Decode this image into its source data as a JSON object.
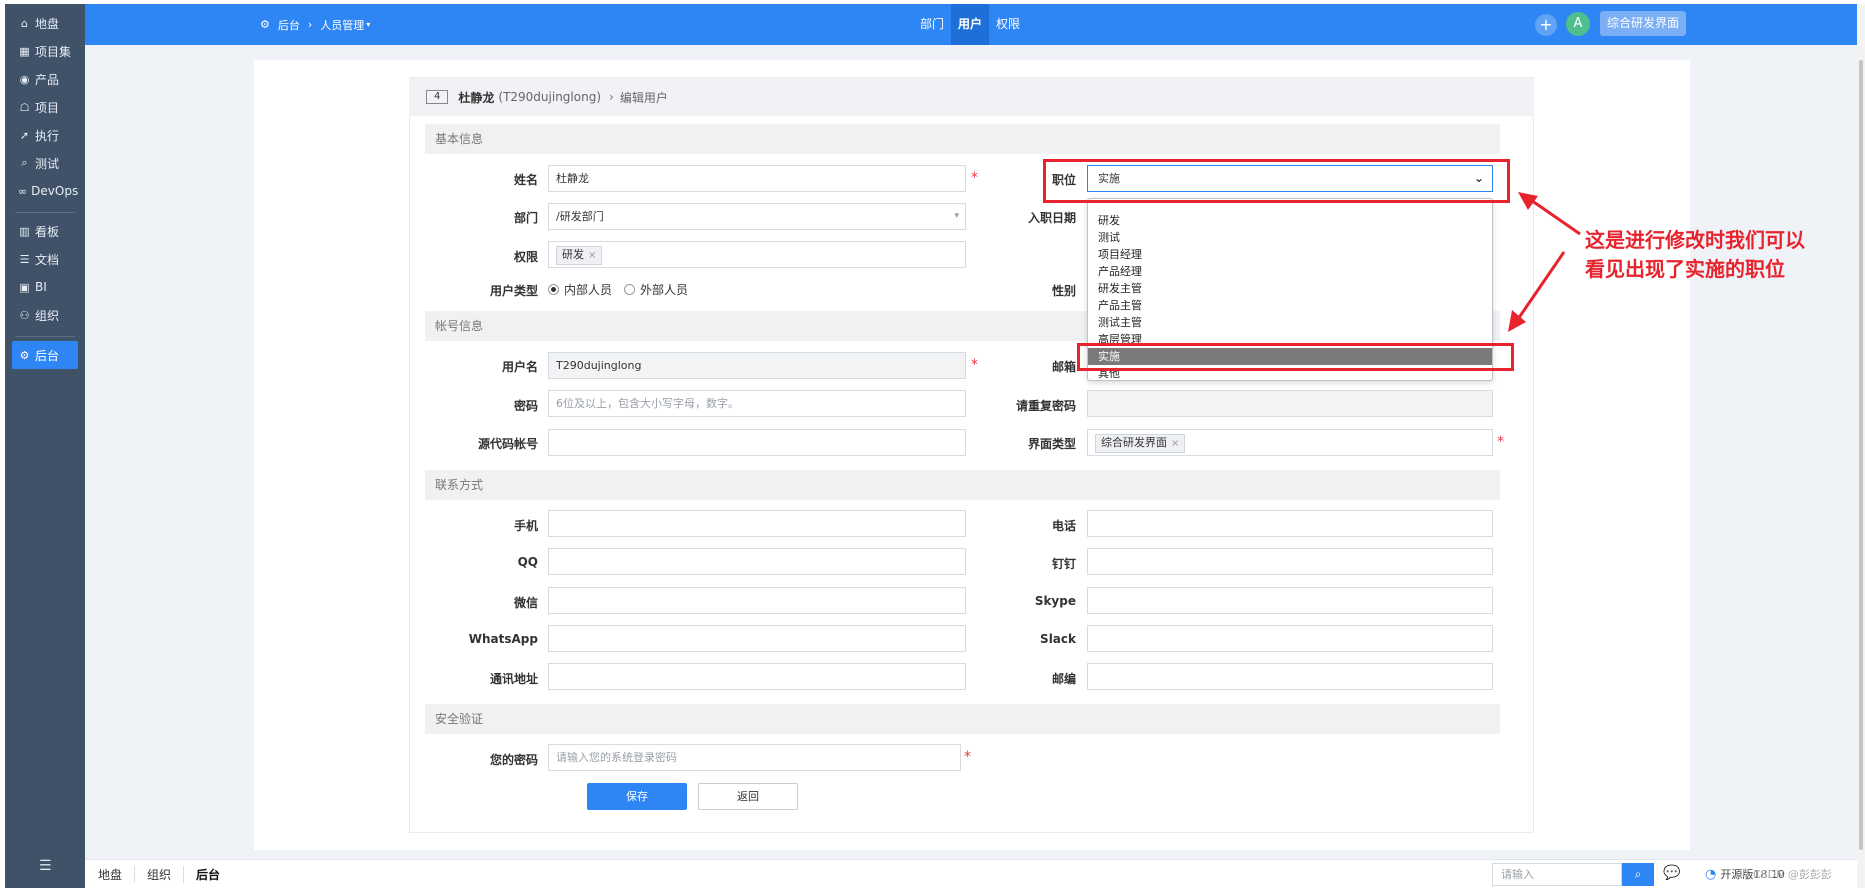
{
  "sidebar": {
    "items": [
      {
        "icon": "home-icon",
        "glyph": "⌂",
        "label": "地盘"
      },
      {
        "icon": "grid-icon",
        "glyph": "▦",
        "label": "项目集"
      },
      {
        "icon": "product-icon",
        "glyph": "◉",
        "label": "产品"
      },
      {
        "icon": "project-icon",
        "glyph": "☖",
        "label": "项目"
      },
      {
        "icon": "execute-icon",
        "glyph": "➚",
        "label": "执行"
      },
      {
        "icon": "test-icon",
        "glyph": "⌕",
        "label": "测试"
      },
      {
        "icon": "devops-icon",
        "glyph": "∞",
        "label": "DevOps"
      },
      {
        "icon": "kanban-icon",
        "glyph": "▥",
        "label": "看板"
      },
      {
        "icon": "doc-icon",
        "glyph": "☰",
        "label": "文档"
      },
      {
        "icon": "bi-icon",
        "glyph": "▣",
        "label": "BI"
      },
      {
        "icon": "org-icon",
        "glyph": "⚇",
        "label": "组织"
      },
      {
        "icon": "admin-icon",
        "glyph": "⚙",
        "label": "后台"
      }
    ],
    "collapse_glyph": "☰"
  },
  "header": {
    "crumb_home": "后台",
    "crumb_page": "人员管理",
    "tabs": [
      "部门",
      "用户",
      "权限"
    ],
    "plus": "+",
    "avatar": "A",
    "ui_switch": "综合研发界面"
  },
  "title_bar": {
    "id": "4",
    "name": "杜静龙",
    "account": "(T290dujinglong)",
    "sep": "›",
    "action": "编辑用户"
  },
  "sections": {
    "basic": "基本信息",
    "account": "帐号信息",
    "contact": "联系方式",
    "security": "安全验证"
  },
  "labels": {
    "realname": "姓名",
    "dept": "部门",
    "priv": "权限",
    "user_type": "用户类型",
    "role": "职位",
    "join_date": "入职日期",
    "gender": "性别",
    "account": "用户名",
    "email": "邮箱",
    "password": "密码",
    "password2": "请重复密码",
    "commiter": "源代码帐号",
    "vision": "界面类型",
    "mobile": "手机",
    "phone": "电话",
    "qq": "QQ",
    "dingding": "钉钉",
    "weixin": "微信",
    "skype": "Skype",
    "whatsapp": "WhatsApp",
    "slack": "Slack",
    "address": "通讯地址",
    "zipcode": "邮编",
    "verify": "您的密码"
  },
  "values": {
    "realname": "杜静龙",
    "dept": "/研发部门",
    "priv_chip": "研发",
    "user_type_inside": "内部人员",
    "user_type_outside": "外部人员",
    "role": "实施",
    "account": "T290dujinglong",
    "password_ph": "6位及以上，包含大小写字母，数字。",
    "vision_chip": "综合研发界面",
    "verify_ph": "请输入您的系统登录密码",
    "required_mark": "*",
    "chip_close": "×"
  },
  "role_dropdown": {
    "options": [
      "研发",
      "测试",
      "项目经理",
      "产品经理",
      "研发主管",
      "产品主管",
      "测试主管",
      "高层管理",
      "实施",
      "其他"
    ],
    "selected": "实施"
  },
  "annotation": {
    "line1": "这是进行修改时我们可以",
    "line2": "看见出现了实施的职位"
  },
  "buttons": {
    "save": "保存",
    "back": "返回"
  },
  "footer": {
    "nav": [
      "地盘",
      "组织",
      "后台"
    ],
    "search_ph": "请输入",
    "version": "开源版18.10",
    "watermark": "CSDN @彭彭彭"
  },
  "colors": {
    "primary": "#2e86f4",
    "sidebar": "#3f5268",
    "annotation": "#e8232d"
  }
}
